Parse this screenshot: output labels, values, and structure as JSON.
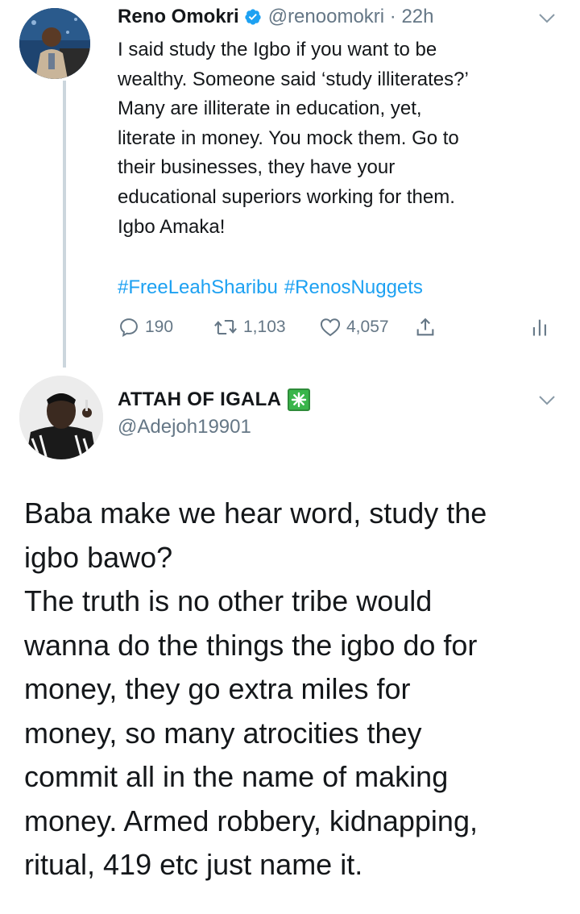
{
  "tweet1": {
    "author_name": "Reno Omokri",
    "handle": "@renoomokri",
    "time": "22h",
    "text": "I said study the Igbo if you want to be\nwealthy. Someone said ‘study illiterates?’\nMany are illiterate in education, yet,\nliterate in money. You mock them. Go to\ntheir businesses, they have your\neducational superiors working for them.\nIgbo Amaka!",
    "hashtags": [
      "#FreeLeahSharibu",
      "#RenosNuggets"
    ],
    "replies": "190",
    "retweets": "1,103",
    "likes": "4,057",
    "verified": true
  },
  "tweet2": {
    "author_name": "ATTAH OF IGALA",
    "name_emoji": "sparkle-emoji",
    "handle": "@Adejoh19901",
    "text": "Baba make we hear word, study the\nigbo bawo?\nThe truth is no other tribe would\nwanna do the things the igbo do for\nmoney, they go extra miles for\nmoney, so many atrocities they\ncommit all in the name of making\nmoney. Armed robbery, kidnapping,\nritual, 419 etc just name it."
  },
  "icons": {
    "verified": "verified-badge-icon",
    "reply": "reply-icon",
    "retweet": "retweet-icon",
    "like": "heart-icon",
    "share": "share-icon",
    "analytics": "analytics-icon",
    "more": "chevron-down-icon"
  },
  "colors": {
    "link": "#1da1f2",
    "secondary_text": "#657786",
    "thread_line": "#ccd6dd",
    "badge_green": "#39b54a"
  }
}
